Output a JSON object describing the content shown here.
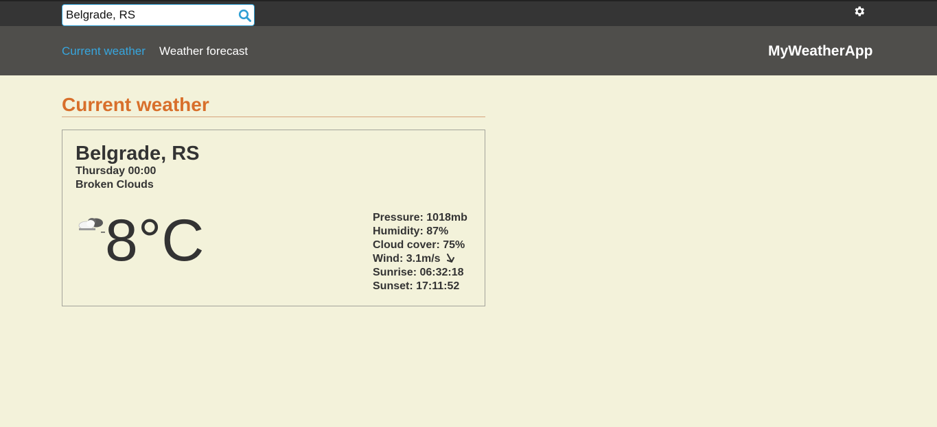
{
  "search": {
    "value": "Belgrade, RS",
    "icon": "search-icon"
  },
  "header": {
    "settings_icon": "gear-icon"
  },
  "nav": {
    "items": [
      {
        "label": "Current weather",
        "active": true
      },
      {
        "label": "Weather forecast",
        "active": false
      }
    ],
    "brand": "MyWeatherApp"
  },
  "main": {
    "title": "Current weather",
    "card": {
      "city": "Belgrade, RS",
      "datetime": "Thursday 00:00",
      "condition": "Broken Clouds",
      "icon": "broken-clouds-icon",
      "temperature": "8°C",
      "details": {
        "pressure": "Pressure: 1018mb",
        "humidity": "Humidity: 87%",
        "cloud_cover": "Cloud cover: 75%",
        "wind": "Wind: 3.1m/s",
        "wind_direction_icon": "wind-direction-arrow-icon",
        "sunrise": "Sunrise: 06:32:18",
        "sunset": "Sunset: 17:11:52"
      }
    }
  },
  "colors": {
    "accent_blue": "#37a6de",
    "title_orange": "#d86f2b",
    "page_bg": "#f3f2da",
    "topbar_bg": "#353535",
    "navbar_bg": "#4f4e4b"
  }
}
